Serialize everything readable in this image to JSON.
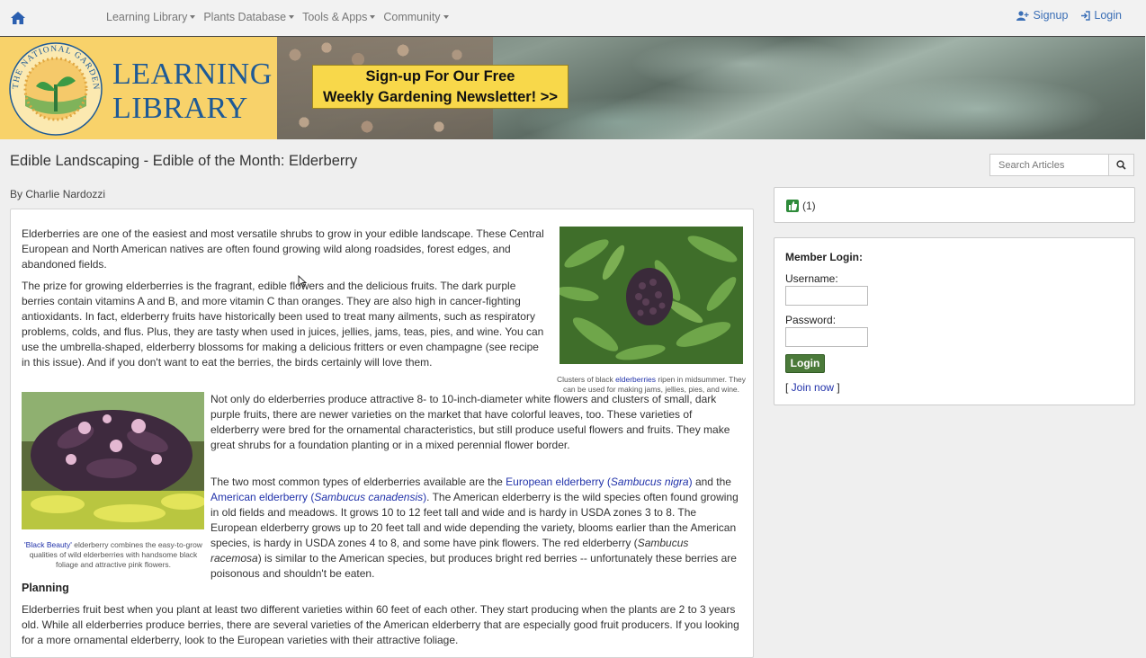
{
  "nav": {
    "menu": [
      "Learning Library",
      "Plants Database",
      "Tools & Apps",
      "Community"
    ],
    "signup": "Signup",
    "login": "Login"
  },
  "banner": {
    "logo_line1": "LEARNING",
    "logo_line2": "LIBRARY",
    "seal_text": "THE NATIONAL GARDENING ASSOCIATION",
    "newsletter_line1": "Sign-up For Our Free",
    "newsletter_line2": "Weekly Gardening Newsletter! >>"
  },
  "page": {
    "title": "Edible Landscaping - Edible of the Month: Elderberry",
    "search_placeholder": "Search Articles",
    "byline": "By Charlie Nardozzi"
  },
  "article": {
    "p1": "Elderberries are one of the easiest and most versatile shrubs to grow in your edible landscape. These Central European and North American natives are often found growing wild along roadsides, forest edges, and abandoned fields.",
    "p2": "The prize for growing elderberries is the fragrant, edible flowers and the delicious fruits. The dark purple berries contain vitamins A and B, and more vitamin C than oranges. They are also high in cancer-fighting antioxidants. In fact, elderberry fruits have historically been used to treat many ailments, such as respiratory problems, colds, and flus. Plus, they are tasty when used in juices, jellies, jams, teas, pies, and wine. You can use the umbrella-shaped, elderberry blossoms for making a delicious fritters or even champagne (see recipe in this issue). And if you don't want to eat the berries, the birds certainly will love them.",
    "p3": "Not only do elderberries produce attractive 8- to 10-inch-diameter white flowers and clusters of small, dark purple fruits, there are newer varieties on the market that have colorful leaves, too. These varieties of elderberry were bred for the ornamental characteristics, but still produce useful flowers and fruits. They make great shrubs for a foundation planting or in a mixed perennial flower border.",
    "p4_a": "The two most common types of elderberries available are the ",
    "p4_link1": "European elderberry (",
    "p4_link1_italic": "Sambucus nigra",
    "p4_link1_end": ")",
    "p4_b": " and the ",
    "p4_link2": "American elderberry (",
    "p4_link2_italic": "Sambucus canadensis",
    "p4_link2_end": ")",
    "p4_c": ". The American elderberry is the wild species often found growing in old fields and meadows. It grows 10 to 12 feet tall and wide and is hardy in USDA zones 3 to 8. The European elderberry grows up to 20 feet tall and wide depending the variety, blooms earlier than the American species, is hardy in USDA zones 4 to 8, and some have pink flowers. The red elderberry (",
    "p4_italic3": "Sambucus racemosa",
    "p4_d": ") is similar to the American species, but produces bright red berries -- unfortunately these berries are poisonous and shouldn't be eaten.",
    "heading_planning": "Planning",
    "p5": "Elderberries fruit best when you plant at least two different varieties within 60 feet of each other. They start producing when the plants are 2 to 3 years old. While all elderberries produce berries, there are several varieties of the American elderberry that are especially good fruit producers. If you looking for a more ornamental elderberry, look to the European varieties with their attractive foliage.",
    "caption1_a": "Clusters of black ",
    "caption1_link": "elderberries",
    "caption1_b": " ripen in midsummer. They can be used for making jams, jellies, pies, and wine.",
    "caption2_link": "'Black Beauty'",
    "caption2_b": " elderberry combines the easy-to-grow qualities of wild elderberries with handsome black foliage and attractive pink flowers."
  },
  "sidebar": {
    "like_count": "(1)",
    "login_title": "Member Login:",
    "username_label": "Username:",
    "password_label": "Password:",
    "login_button": "Login",
    "join_prefix": "[ ",
    "join_link": "Join now",
    "join_suffix": " ]"
  },
  "colors": {
    "accent_link": "#2233aa",
    "nav_link": "#3b6fb6",
    "logo_bg": "#f8d26a",
    "newsletter_bg": "#f8d84a",
    "login_button": "#4b7a3a",
    "like_icon": "#2e8b3a"
  }
}
